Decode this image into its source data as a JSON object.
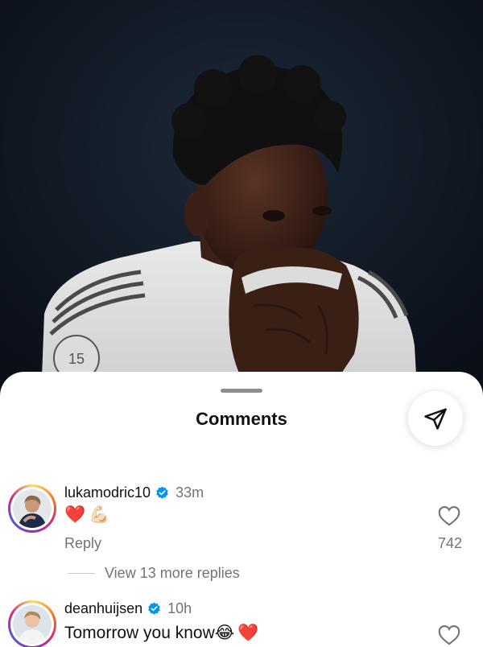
{
  "sheet": {
    "title": "Comments"
  },
  "comments": [
    {
      "username": "lukamodric10",
      "time": "33m",
      "emojis": [
        "❤️",
        "💪🏻"
      ],
      "reply_label": "Reply",
      "likes": "742",
      "view_replies": "View 13 more replies"
    },
    {
      "username": "deanhuijsen",
      "time": "10h",
      "text": "Tomorrow you know",
      "emojis": [
        "😂",
        "❤️"
      ]
    }
  ],
  "colors": {
    "verified": "#0095f6",
    "muted": "#737373"
  },
  "icons": [
    "share-icon",
    "verified-icon",
    "heart-outline-icon"
  ]
}
